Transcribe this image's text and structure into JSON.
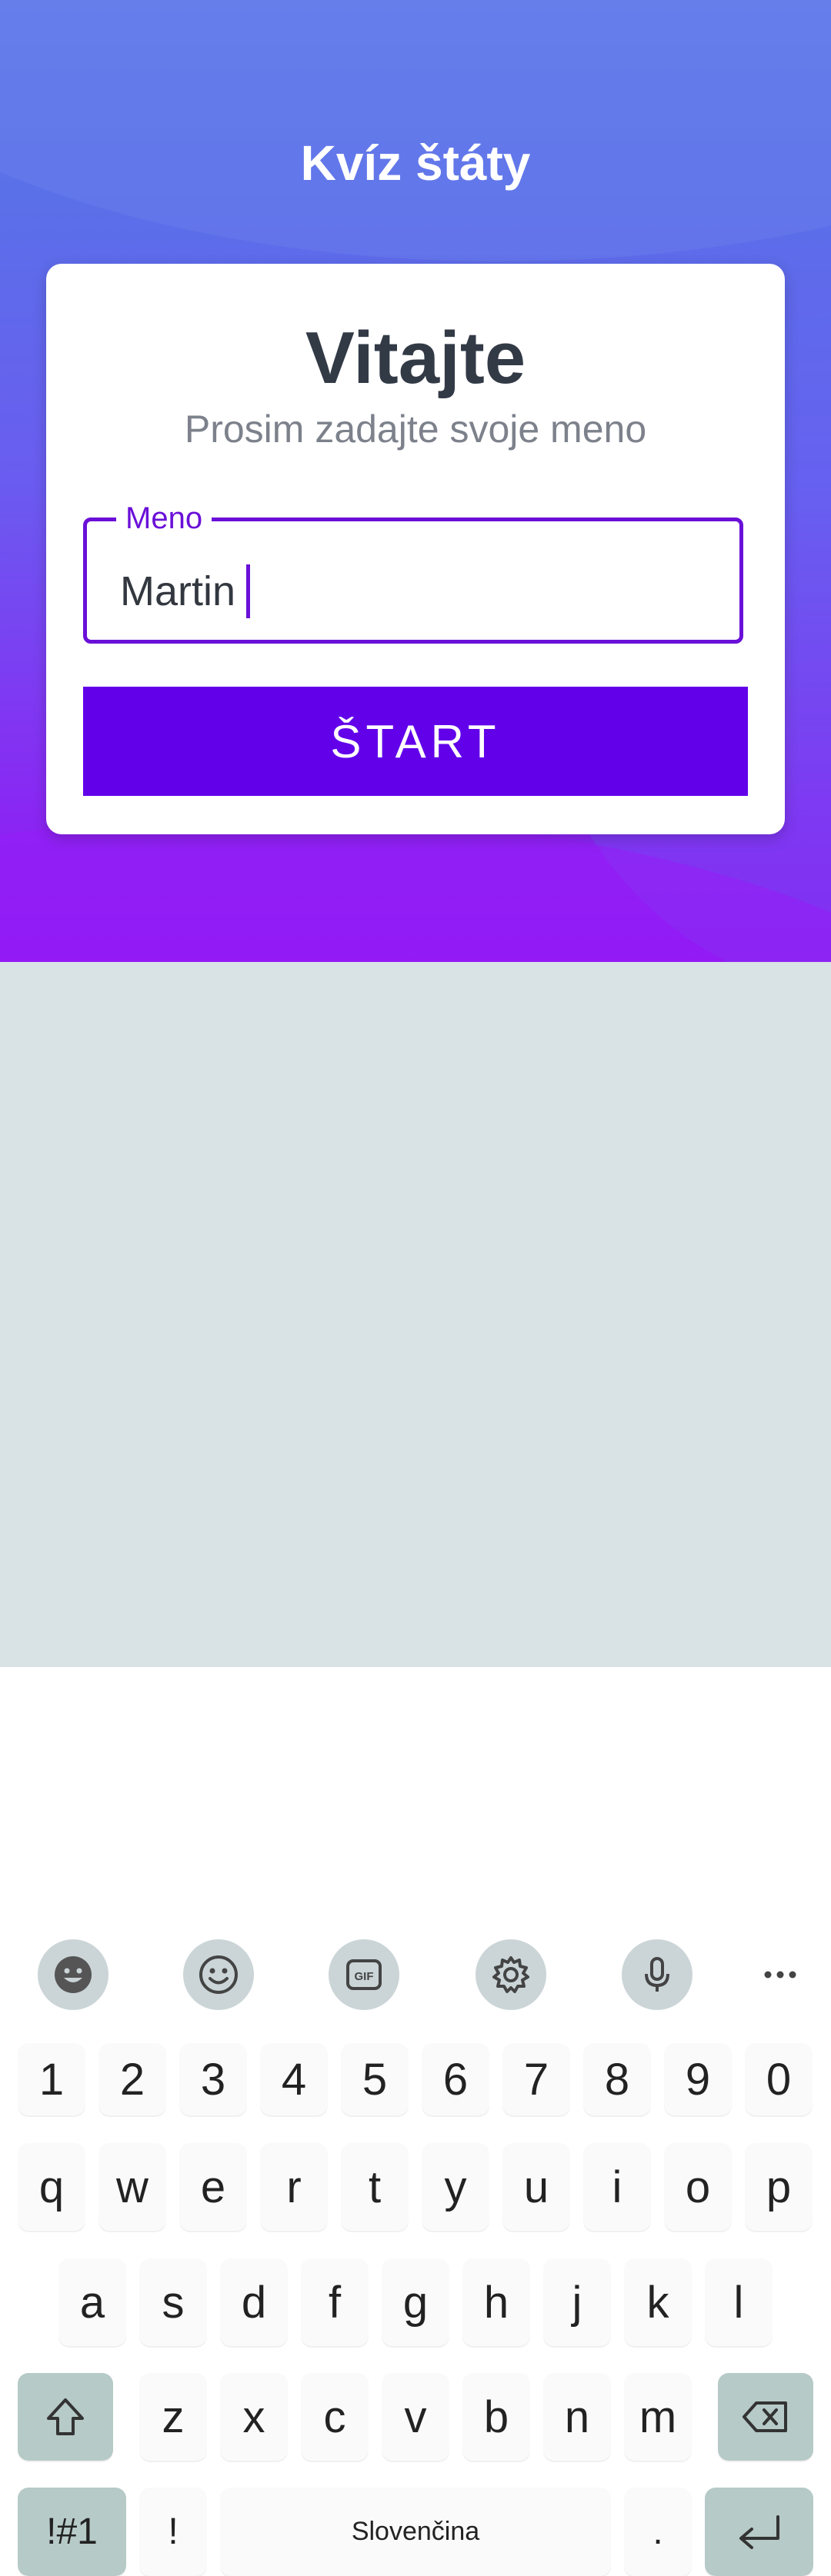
{
  "app": {
    "title": "Kvíz štáty"
  },
  "card": {
    "heading": "Vitajte",
    "subtitle": "Prosim zadajte svoje meno",
    "field": {
      "label": "Meno",
      "value": "Martin"
    },
    "start_label": "ŠTART"
  },
  "keyboard": {
    "toolbar": [
      "sticker-icon",
      "emoji-icon",
      "gif-icon",
      "settings-icon",
      "microphone-icon",
      "more-icon"
    ],
    "row_numbers": [
      "1",
      "2",
      "3",
      "4",
      "5",
      "6",
      "7",
      "8",
      "9",
      "0"
    ],
    "row_top": [
      "q",
      "w",
      "e",
      "r",
      "t",
      "y",
      "u",
      "i",
      "o",
      "p"
    ],
    "row_middle": [
      "a",
      "s",
      "d",
      "f",
      "g",
      "h",
      "j",
      "k",
      "l"
    ],
    "row_bottom": [
      "z",
      "x",
      "c",
      "v",
      "b",
      "n",
      "m"
    ],
    "symbols_label": "!#1",
    "exclaim_label": "!",
    "space_label": "Slovenčina",
    "period_label": ".",
    "shift_icon": "shift-icon",
    "backspace_icon": "backspace-icon",
    "enter_icon": "enter-icon"
  },
  "colors": {
    "accent": "#6200ea",
    "field_border": "#6a10d8",
    "keyboard_bg": "#d9e2e4",
    "function_key": "#b6cac7"
  }
}
